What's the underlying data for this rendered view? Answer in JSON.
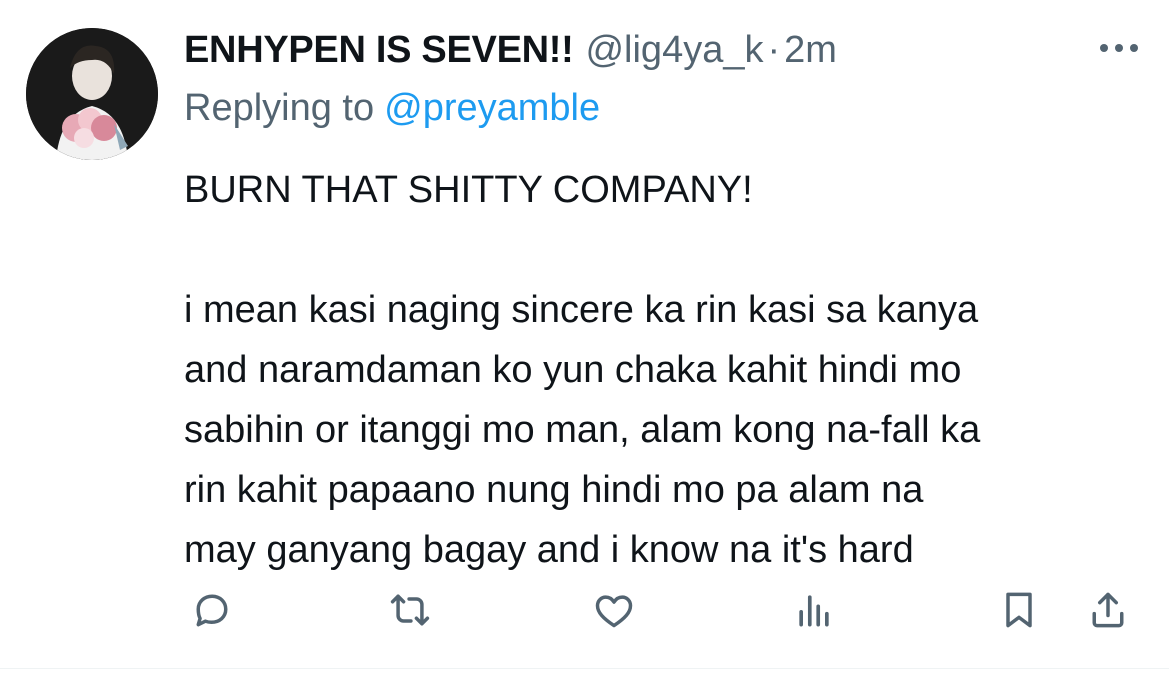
{
  "tweet": {
    "display_name": "ENHYPEN IS SEVEN!!",
    "handle": "@lig4ya_k",
    "separator": "·",
    "time": "2m",
    "replying_prefix": "Replying to",
    "replying_to": "@preyamble",
    "lines": [
      "BURN THAT SHITTY COMPANY!",
      "",
      "i mean kasi naging sincere ka rin kasi sa kanya",
      "and naramdaman ko yun chaka kahit hindi mo",
      "sabihin or itanggi mo man, alam kong na-fall ka",
      "rin kahit papaano nung hindi mo pa alam na",
      "may ganyang bagay and i know na it's hard"
    ]
  },
  "actions": [
    {
      "icon": "reply-icon"
    },
    {
      "icon": "retweet-icon"
    },
    {
      "icon": "like-icon"
    },
    {
      "icon": "views-icon"
    },
    {
      "icon": "bookmark-icon"
    },
    {
      "icon": "share-icon"
    }
  ],
  "colors": {
    "text": "#0f1419",
    "secondary": "#536471",
    "link": "#1d9bf0"
  }
}
